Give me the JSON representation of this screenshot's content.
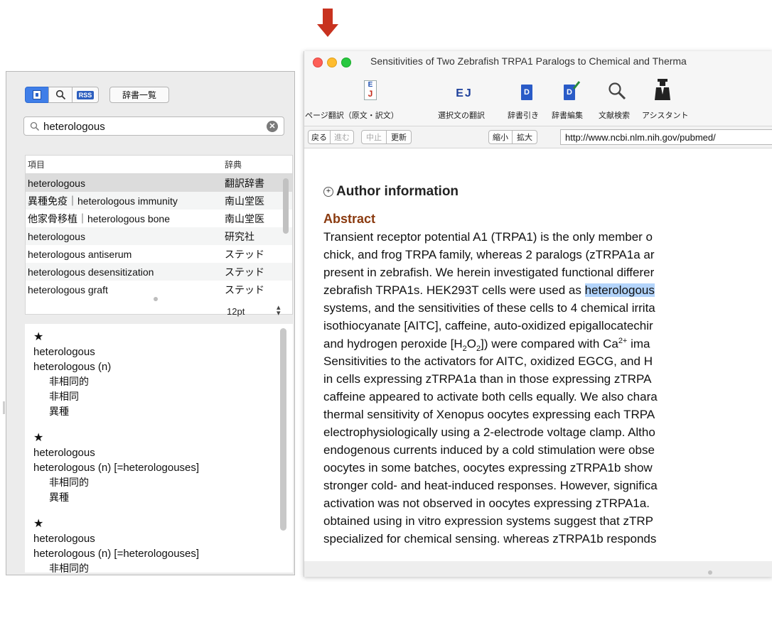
{
  "dict_panel": {
    "toolbar": {
      "rss_label": "RSS",
      "dict_list_label": "辞書一覧"
    },
    "search": {
      "value": "heterologous",
      "clear_glyph": "✕"
    },
    "results": {
      "columns": [
        "項目",
        "辞典"
      ],
      "rows": [
        {
          "term": "heterologous",
          "dict": "翻訳辞書"
        },
        {
          "term": "異種免疫｜heterologous immunity",
          "dict": "南山堂医"
        },
        {
          "term": "他家骨移植｜heterologous bone",
          "dict": "南山堂医"
        },
        {
          "term": "heterologous",
          "dict": "研究社"
        },
        {
          "term": "heterologous antiserum",
          "dict": "ステッド"
        },
        {
          "term": "heterologous desensitization",
          "dict": "ステッド"
        },
        {
          "term": "heterologous graft",
          "dict": "ステッド"
        }
      ]
    },
    "font_size": "12pt",
    "entries": [
      {
        "star": "★",
        "headword": "heterologous",
        "pos": "heterologous (n)",
        "senses": [
          "非相同的",
          "非相同",
          "異種"
        ]
      },
      {
        "star": "★",
        "headword": "heterologous",
        "pos": "heterologous (n) [=heterologouses]",
        "senses": [
          "非相同的",
          "異種"
        ]
      },
      {
        "star": "★",
        "headword": "heterologous",
        "pos": "heterologous (n) [=heterologouses]",
        "senses": [
          "非相同的"
        ]
      }
    ]
  },
  "browser": {
    "title": "Sensitivities of Two Zebrafish TRPA1 Paralogs to Chemical and Therma",
    "toolbar_icons": {
      "page": "J",
      "ej": "EJ",
      "lookup": "D",
      "edit": "D"
    },
    "toolbar_labels": [
      "ページ翻訳（原文・訳文）",
      "選択文の翻訳",
      "辞書引き",
      "辞書編集",
      "文献検索",
      "アシスタント"
    ],
    "nav": {
      "back": "戻る",
      "forward": "進む",
      "stop": "中止",
      "reload": "更新",
      "zoom_out": "縮小",
      "zoom_in": "拡大"
    },
    "url": "http://www.ncbi.nlm.nih.gov/pubmed/",
    "content": {
      "author_heading": "Author information",
      "plus_glyph": "+",
      "abstract_heading": "Abstract",
      "lines": [
        "Transient receptor potential A1 (TRPA1) is the only member o",
        "chick, and frog TRPA family, whereas 2 paralogs (zTRPA1a ar",
        "present in zebrafish. We herein investigated functional differer",
        {
          "before": "zebrafish TRPA1s. HEK293T cells were used as ",
          "highlight": "heterologous"
        },
        "systems, and the sensitivities of these cells to 4 chemical irrita",
        "isothiocyanate [AITC], caffeine, auto-oxidized epigallocatechir",
        {
          "before": "and hydrogen peroxide [H",
          "sub1": "2",
          "mid": "O",
          "sub2": "2",
          "after": "]) were compared with Ca",
          "sup": "2+",
          "end": " ima"
        },
        "Sensitivities to the activators for AITC, oxidized EGCG, and H",
        "in cells expressing zTRPA1a than in those expressing zTRPA",
        "caffeine appeared to activate both cells equally. We also chara",
        "thermal sensitivity of Xenopus oocytes expressing each TRPA",
        "electrophysiologically using a 2-electrode voltage clamp. Altho",
        "endogenous currents induced by a cold stimulation were obse",
        "oocytes in some batches, oocytes expressing zTRPA1b show",
        "stronger cold- and heat-induced responses. However, significa",
        "activation was not observed in oocytes expressing zTRPA1a.",
        "obtained using in vitro expression systems suggest that zTRP",
        "specialized for chemical sensing. whereas zTRPA1b responds"
      ]
    }
  }
}
